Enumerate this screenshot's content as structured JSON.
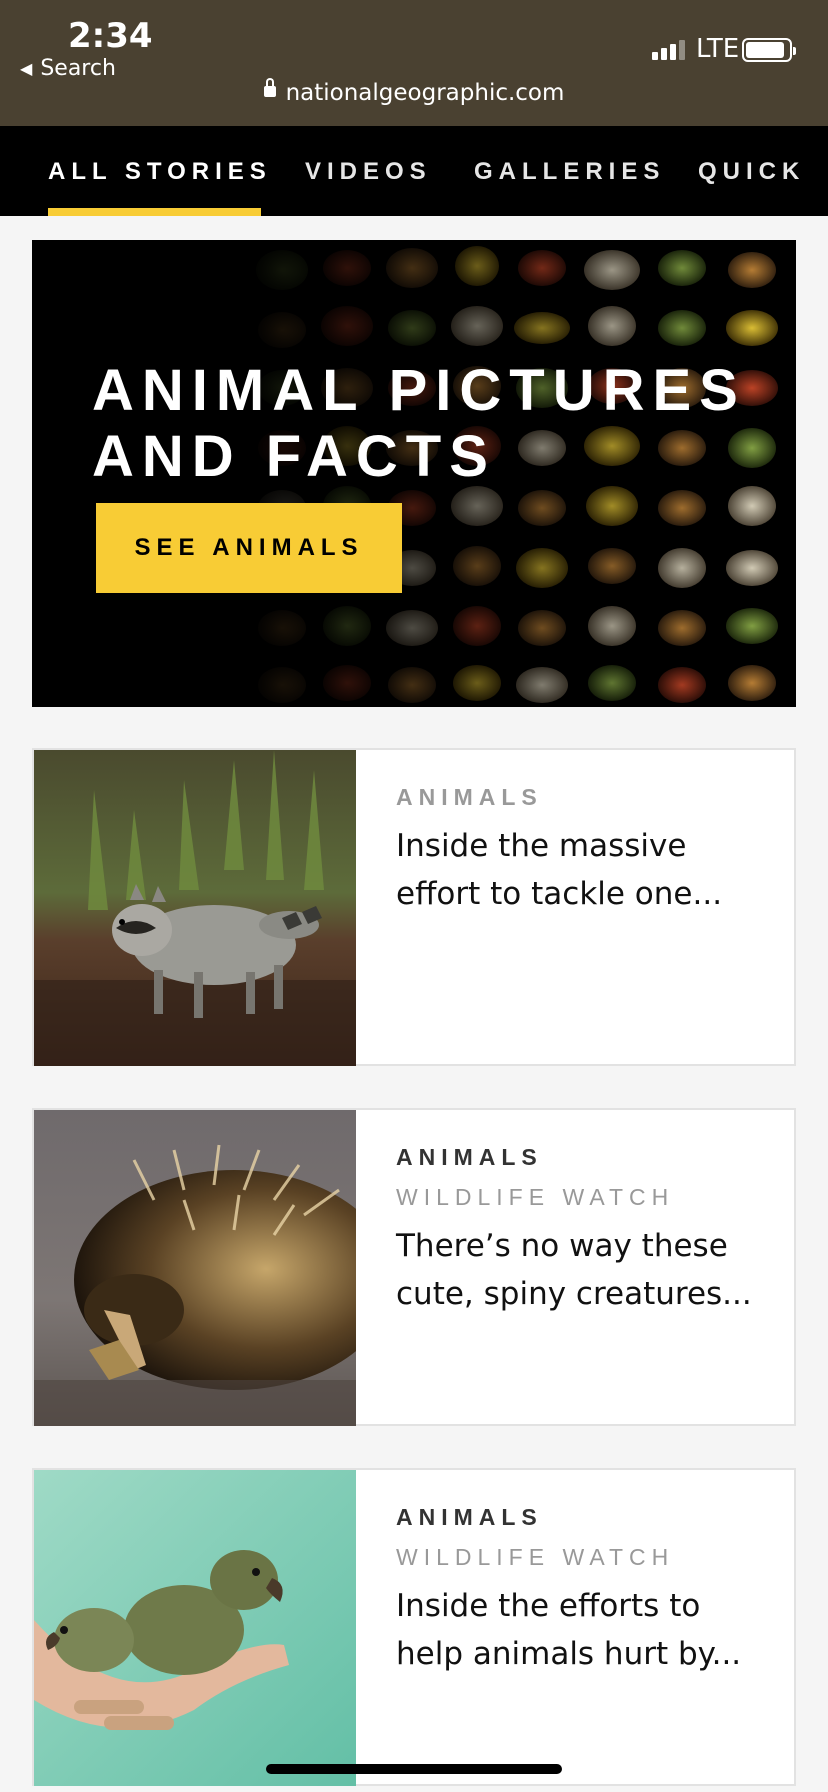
{
  "status_bar": {
    "time": "2:34",
    "back_label": "Search",
    "network": "LTE"
  },
  "address_bar": {
    "url": "nationalgeographic.com"
  },
  "nav": {
    "tabs": [
      {
        "label": "ALL STORIES",
        "active": true
      },
      {
        "label": "VIDEOS",
        "active": false
      },
      {
        "label": "GALLERIES",
        "active": false
      },
      {
        "label": "QUICK",
        "active": false
      }
    ]
  },
  "hero": {
    "title_line1": "ANIMAL PICTURES",
    "title_line2": "AND FACTS",
    "button_label": "SEE ANIMALS"
  },
  "stories": [
    {
      "category": "ANIMALS",
      "subcategory": "",
      "headline_line1": "Inside the massive",
      "headline_line2": "effort to tackle one...",
      "image": "raccoon"
    },
    {
      "category": "ANIMALS",
      "subcategory": "WILDLIFE WATCH",
      "headline_line1": "There’s no way these",
      "headline_line2": "cute, spiny creatures...",
      "image": "echidna"
    },
    {
      "category": "ANIMALS",
      "subcategory": "WILDLIFE WATCH",
      "headline_line1": "Inside the efforts to",
      "headline_line2": "help animals hurt by...",
      "image": "baby-parrots-in-hand"
    }
  ],
  "colors": {
    "accent": "#f8cc35",
    "nav_bg": "#000000",
    "topbar_bg": "#4a4131"
  }
}
